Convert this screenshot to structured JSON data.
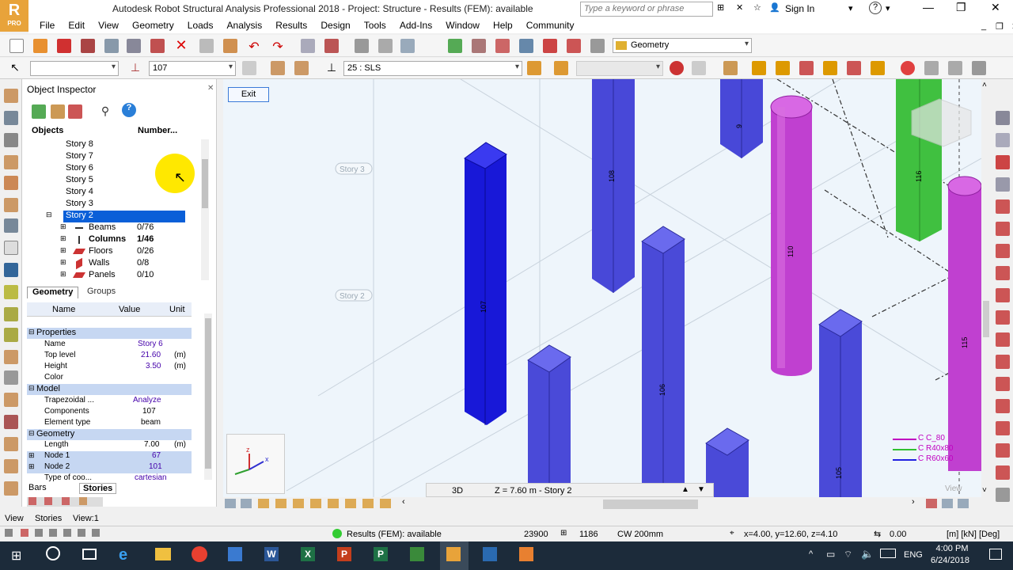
{
  "app": {
    "title": "Autodesk Robot Structural Analysis Professional 2018 - Project: Structure - Results (FEM): available",
    "logo_letter": "R",
    "logo_sub": "PRO",
    "search_placeholder": "Type a keyword or phrase",
    "signin": "Sign In"
  },
  "menu": [
    "File",
    "Edit",
    "View",
    "Geometry",
    "Loads",
    "Analysis",
    "Results",
    "Design",
    "Tools",
    "Add-Ins",
    "Window",
    "Help",
    "Community"
  ],
  "toolbar": {
    "layout_combo": "Geometry",
    "bar_combo": "107",
    "case_combo": "25 : SLS"
  },
  "inspector": {
    "title": "Object Inspector",
    "col_objects": "Objects",
    "col_number": "Number...",
    "stories": [
      "Story 8",
      "Story 7",
      "Story 6",
      "Story 5",
      "Story 4",
      "Story 3"
    ],
    "selected_story": "Story 2",
    "children": [
      {
        "label": "Beams",
        "count": "0/76"
      },
      {
        "label": "Columns",
        "count": "1/46"
      },
      {
        "label": "Floors",
        "count": "0/26"
      },
      {
        "label": "Walls",
        "count": "0/8"
      },
      {
        "label": "Panels",
        "count": "0/10"
      }
    ],
    "tabs": [
      "Geometry",
      "Groups"
    ],
    "prop_headers": {
      "name": "Name",
      "value": "Value",
      "unit": "Unit"
    },
    "sections": {
      "properties": "Properties",
      "model": "Model",
      "geometry": "Geometry"
    },
    "props": [
      {
        "name": "Name",
        "value": "Story 6",
        "unit": ""
      },
      {
        "name": "Top level",
        "value": "21.60",
        "unit": "(m)"
      },
      {
        "name": "Height",
        "value": "3.50",
        "unit": "(m)"
      },
      {
        "name": "Color",
        "value": "",
        "unit": ""
      }
    ],
    "model_props": [
      {
        "name": "Trapezoidal ...",
        "value": "Analyze",
        "unit": ""
      },
      {
        "name": "Components",
        "value": "107",
        "unit": ""
      },
      {
        "name": "Element type",
        "value": "beam",
        "unit": ""
      }
    ],
    "geom_props": [
      {
        "name": "Length",
        "value": "7.00",
        "unit": "(m)"
      },
      {
        "name": "Node 1",
        "value": "67",
        "unit": ""
      },
      {
        "name": "Node 2",
        "value": "101",
        "unit": ""
      },
      {
        "name": "Type of coo...",
        "value": "cartesian",
        "unit": ""
      }
    ],
    "bottom_tabs": [
      "Bars",
      "Stories"
    ]
  },
  "viewport": {
    "exit_label": "Exit",
    "story_labels": [
      "Story 3",
      "Story 2"
    ],
    "view_mode": "3D",
    "z_info": "Z = 7.60 m - Story 2",
    "column_labels": [
      "107",
      "108",
      "106",
      "9",
      "110",
      "116",
      "115",
      "105"
    ],
    "legend": [
      {
        "label": "C C_80",
        "color": "#c000c0"
      },
      {
        "label": "C R40x80",
        "color": "#30c030"
      },
      {
        "label": "C R60x60",
        "color": "#2020e0"
      }
    ],
    "view_cube_label": "View"
  },
  "bottom_view_tabs": [
    "View",
    "Stories",
    "View:1"
  ],
  "status": {
    "results": "Results (FEM): available",
    "num1": "23900",
    "num2": "1186",
    "section": "CW 200mm",
    "coords": "x=4.00, y=12.60, z=4.10",
    "value": "0.00",
    "units": "[m] [kN] [Deg]"
  },
  "taskbar": {
    "time": "4:00 PM",
    "date": "6/24/2018",
    "lang": "ENG"
  },
  "colors": {
    "blue_column": "#2a2ae0",
    "purple_column": "#c040d0",
    "green_column": "#40c040",
    "selection": "#0a5fd8",
    "section_header": "#c6d7f2"
  }
}
